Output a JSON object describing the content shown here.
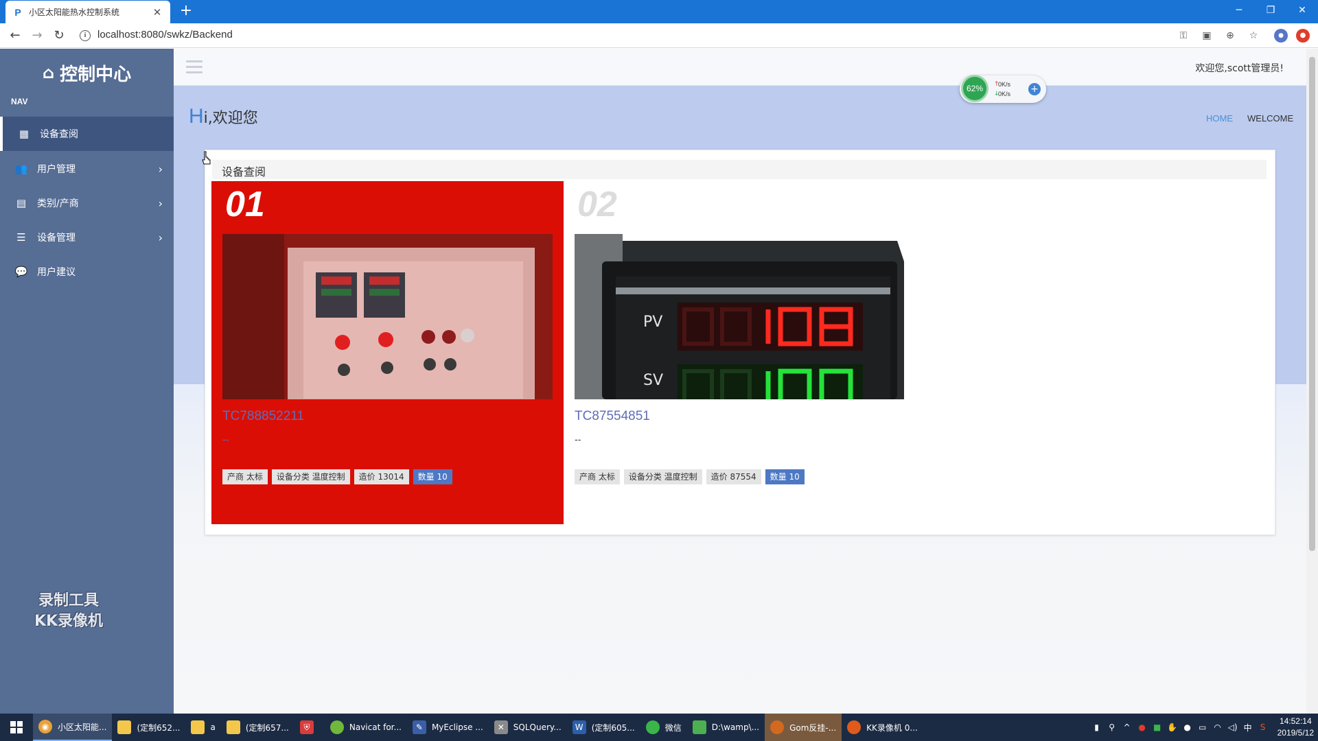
{
  "browser": {
    "tab_title": "小区太阳能热水控制系统",
    "favicon": "P",
    "url": "localhost:8080/swkz/Backend"
  },
  "sidebar": {
    "brand": "控制中心",
    "nav_label": "NAV",
    "items": [
      {
        "label": "设备查阅",
        "icon": "grid-icon",
        "active": true,
        "has_chevron": false
      },
      {
        "label": "用户管理",
        "icon": "users-icon",
        "active": false,
        "has_chevron": true
      },
      {
        "label": "类别/产商",
        "icon": "file-icon",
        "active": false,
        "has_chevron": true
      },
      {
        "label": "设备管理",
        "icon": "list-icon",
        "active": false,
        "has_chevron": true
      },
      {
        "label": "用户建议",
        "icon": "chat-icon",
        "active": false,
        "has_chevron": false
      }
    ],
    "watermark": [
      "录制工具",
      "KK录像机"
    ]
  },
  "topbar": {
    "welcome": "欢迎您,scott管理员!"
  },
  "net_widget": {
    "percent": "62%",
    "up": "0K/s",
    "down": "0K/s"
  },
  "header": {
    "title_big": "H",
    "title_rest": "i,欢迎您",
    "crumb_home": "HOME",
    "crumb_current": "WELCOME"
  },
  "panel": {
    "title": "设备查阅",
    "devices": [
      {
        "num": "01",
        "code": "TC788852211",
        "desc": "--",
        "tags": [
          "产商 太标",
          "设备分类 温度控制",
          "造价 13014"
        ],
        "count": "数量 10"
      },
      {
        "num": "02",
        "code": "TC87554851",
        "desc": "--",
        "tags": [
          "产商 太标",
          "设备分类 温度控制",
          "造价 87554"
        ],
        "count": "数量 10"
      }
    ],
    "display_pv": "PV",
    "display_sv": "SV"
  },
  "taskbar": {
    "items": [
      {
        "label": "小区太阳能...",
        "icon": "chrome-icon",
        "color": "#e9a23b"
      },
      {
        "label": "(定制652...",
        "icon": "folder-icon",
        "color": "#f3c84a"
      },
      {
        "label": "a",
        "icon": "folder-icon",
        "color": "#f3c84a"
      },
      {
        "label": "(定制657...",
        "icon": "folder-icon",
        "color": "#f3c84a"
      },
      {
        "label": "",
        "icon": "shield-icon",
        "color": "#d83c3c"
      },
      {
        "label": "Navicat for...",
        "icon": "navicat-icon",
        "color": "#6fb83b"
      },
      {
        "label": "MyEclipse ...",
        "icon": "eclipse-icon",
        "color": "#3a5fa8"
      },
      {
        "label": "SQLQuery...",
        "icon": "sql-icon",
        "color": "#8a8a8a"
      },
      {
        "label": "(定制605...",
        "icon": "word-icon",
        "color": "#2b5faa"
      },
      {
        "label": "微信",
        "icon": "wechat-icon",
        "color": "#3bb54a"
      },
      {
        "label": "D:\\wamp\\...",
        "icon": "notepad-icon",
        "color": "#4caf50"
      },
      {
        "label": "Gom反挂-...",
        "icon": "gom-icon",
        "color": "#d2691e"
      },
      {
        "label": "KK录像机 0...",
        "icon": "kk-icon",
        "color": "#e05a1c"
      }
    ],
    "time": "14:52:14",
    "date": "2019/5/12",
    "ime": "中"
  }
}
